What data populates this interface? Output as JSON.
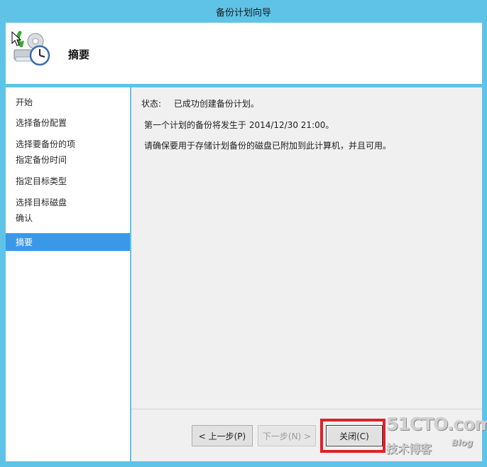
{
  "window": {
    "title": "备份计划向导"
  },
  "header": {
    "heading": "摘要",
    "icon": "backup-schedule-icon"
  },
  "nav": {
    "items": [
      {
        "label": "开始",
        "active": false
      },
      {
        "label": "选择备份配置",
        "active": false
      },
      {
        "label": "选择要备份的项",
        "active": false
      },
      {
        "label": "指定备份时间",
        "active": false
      },
      {
        "label": "指定目标类型",
        "active": false
      },
      {
        "label": "选择目标磁盘",
        "active": false
      },
      {
        "label": "确认",
        "active": false
      },
      {
        "label": "摘要",
        "active": true
      }
    ]
  },
  "content": {
    "status_label": "状态:",
    "status_value": "已成功创建备份计划。",
    "line1": "第一个计划的备份将发生于 2014/12/30 21:00。",
    "line2": "请确保要用于存储计划备份的磁盘已附加到此计算机，并且可用。"
  },
  "footer": {
    "prev_label": "< 上一步(P)",
    "next_label": "下一步(N) >",
    "close_label": "关闭(C)"
  },
  "watermark": {
    "site": "51CTO.com",
    "sub": "技术博客",
    "blog": "Blog"
  },
  "colors": {
    "frame": "#5fc3e8",
    "active_nav": "#3a98e8",
    "highlight": "#e0202a"
  }
}
